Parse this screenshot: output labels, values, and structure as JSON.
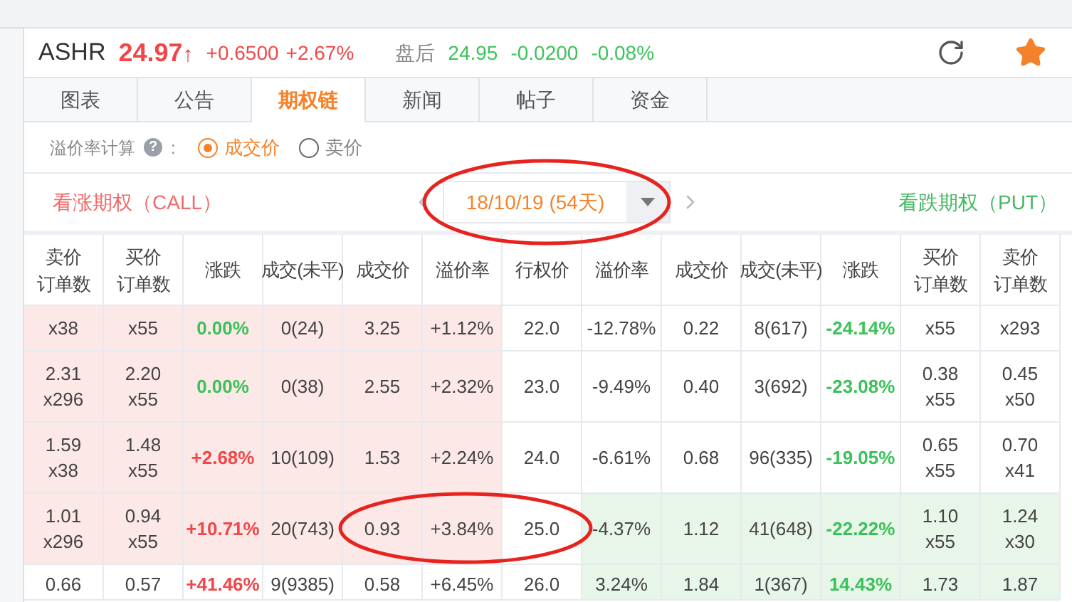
{
  "quote": {
    "symbol": "ASHR",
    "price": "24.97",
    "arrow": "↑",
    "change": "+0.6500",
    "change_pct": "+2.67%",
    "after_label": "盘后",
    "after_price": "24.95",
    "after_change": "-0.0200",
    "after_change_pct": "-0.08%",
    "favorite": true
  },
  "tabs": [
    {
      "label": "图表",
      "selected": false
    },
    {
      "label": "公告",
      "selected": false
    },
    {
      "label": "期权链",
      "selected": true
    },
    {
      "label": "新闻",
      "selected": false
    },
    {
      "label": "帖子",
      "selected": false
    },
    {
      "label": "资金",
      "selected": false
    }
  ],
  "premium_calc": {
    "label": "溢价率计算",
    "help": "?",
    "colon": ":",
    "options": [
      {
        "label": "成交价",
        "selected": true
      },
      {
        "label": "卖价",
        "selected": false
      }
    ]
  },
  "expiry": {
    "call_title": "看涨期权（CALL）",
    "value": "18/10/19 (54天)",
    "put_title": "看跌期权（PUT）"
  },
  "columns": [
    [
      "卖价",
      "订单数"
    ],
    [
      "买价",
      "订单数"
    ],
    [
      "涨跌"
    ],
    [
      "成交(未平)"
    ],
    [
      "成交价"
    ],
    [
      "溢价率"
    ],
    [
      "行权价"
    ],
    [
      "溢价率"
    ],
    [
      "成交价"
    ],
    [
      "成交(未平)"
    ],
    [
      "涨跌"
    ],
    [
      "买价",
      "订单数"
    ],
    [
      "卖价",
      "订单数"
    ]
  ],
  "rows": [
    {
      "call_shaded": true,
      "put_shaded": false,
      "call": {
        "ask_qty": "x38",
        "bid_qty": "x55",
        "change": {
          "text": "0.00%",
          "color": "#3cc25a"
        },
        "volume": "0(24)",
        "price": "3.25",
        "premium": "+1.12%"
      },
      "strike": "22.0",
      "put": {
        "premium": "-12.78%",
        "price": "0.22",
        "volume": "8(617)",
        "change": {
          "text": "-24.14%",
          "color": "#3cc25a"
        },
        "bid_qty": "x55",
        "ask_qty": "x293"
      }
    },
    {
      "call_shaded": true,
      "put_shaded": false,
      "call": {
        "ask": "2.31",
        "ask_qty": "x296",
        "bid": "2.20",
        "bid_qty": "x55",
        "change": {
          "text": "0.00%",
          "color": "#3cc25a"
        },
        "volume": "0(38)",
        "price": "2.55",
        "premium": "+2.32%"
      },
      "strike": "23.0",
      "put": {
        "premium": "-9.49%",
        "price": "0.40",
        "volume": "3(692)",
        "change": {
          "text": "-23.08%",
          "color": "#3cc25a"
        },
        "bid": "0.38",
        "bid_qty": "x55",
        "ask": "0.45",
        "ask_qty": "x50"
      }
    },
    {
      "call_shaded": true,
      "put_shaded": false,
      "call": {
        "ask": "1.59",
        "ask_qty": "x38",
        "bid": "1.48",
        "bid_qty": "x55",
        "change": {
          "text": "+2.68%",
          "color": "#f04848"
        },
        "volume": "10(109)",
        "price": "1.53",
        "premium": "+2.24%"
      },
      "strike": "24.0",
      "put": {
        "premium": "-6.61%",
        "price": "0.68",
        "volume": "96(335)",
        "change": {
          "text": "-19.05%",
          "color": "#3cc25a"
        },
        "bid": "0.65",
        "bid_qty": "x55",
        "ask": "0.70",
        "ask_qty": "x41"
      }
    },
    {
      "call_shaded": true,
      "put_shaded": true,
      "call": {
        "ask": "1.01",
        "ask_qty": "x296",
        "bid": "0.94",
        "bid_qty": "x55",
        "change": {
          "text": "+10.71%",
          "color": "#f04848"
        },
        "volume": "20(743)",
        "price": "0.93",
        "premium": "+3.84%"
      },
      "strike": "25.0",
      "put": {
        "premium": "-4.37%",
        "price": "1.12",
        "volume": "41(648)",
        "change": {
          "text": "-22.22%",
          "color": "#3cc25a"
        },
        "bid": "1.10",
        "bid_qty": "x55",
        "ask": "1.24",
        "ask_qty": "x30"
      }
    },
    {
      "call_shaded": false,
      "put_shaded": true,
      "call": {
        "ask": "0.66",
        "bid": "0.57",
        "change": {
          "text": "+41.46%",
          "color": "#f04848"
        },
        "volume": "9(9385)",
        "price": "0.58",
        "premium": "+6.45%"
      },
      "strike": "26.0",
      "put": {
        "premium": "3.24%",
        "price": "1.84",
        "volume": "1(367)",
        "change": {
          "text": "14.43%",
          "color": "#3cc25a"
        },
        "bid": "1.73",
        "ask": "1.87"
      }
    }
  ]
}
